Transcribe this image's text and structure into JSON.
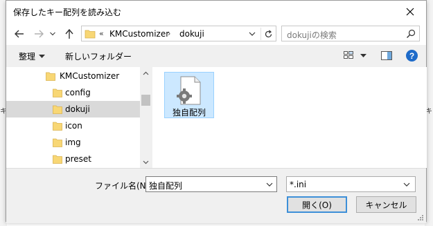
{
  "dialog": {
    "title": "保存したキー配列を読み込む"
  },
  "background": {
    "left_char": "キ",
    "right_char": "キ"
  },
  "nav": {
    "address": {
      "separator1": "«",
      "crumb1": "KMCustomizer",
      "separator2": "›",
      "crumb2": "dokuji"
    },
    "search_placeholder": "dokujiの検索"
  },
  "toolbar": {
    "organize": "整理",
    "new_folder": "新しいフォルダー"
  },
  "tree": {
    "items": [
      {
        "label": "KMCustomizer"
      },
      {
        "label": "config"
      },
      {
        "label": "dokuji"
      },
      {
        "label": "icon"
      },
      {
        "label": "img"
      },
      {
        "label": "preset"
      }
    ]
  },
  "files": [
    {
      "name": "独自配列",
      "icon": "config-file-gear-icon"
    }
  ],
  "bottom": {
    "filename_label": "ファイル名(N):",
    "filename_value": "独自配列",
    "filetype_value": "*.ini",
    "open_button": "開く(O)",
    "cancel_button": "キャンセル"
  },
  "colors": {
    "selection_fill": "#cce8ff",
    "selection_border": "#99d1ff",
    "tree_selected": "#d9d9d9",
    "default_button_border": "#3c8fd8",
    "help_blue": "#1e6bc9",
    "folder_yellow": "#f8d775"
  }
}
